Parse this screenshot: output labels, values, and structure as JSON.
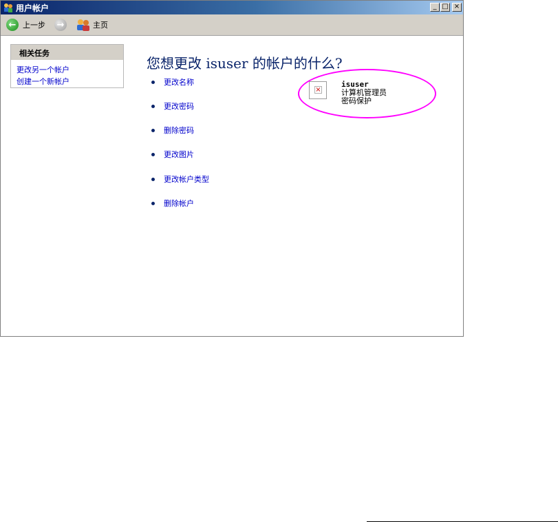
{
  "window": {
    "title": "用户帐户"
  },
  "title_buttons": {
    "minimize": "_",
    "maximize": "□",
    "close": "×"
  },
  "toolbar": {
    "back_label": "上一步",
    "home_label": "主页"
  },
  "task_panel": {
    "header": "相关任务",
    "links": [
      "更改另一个帐户",
      "创建一个新帐户"
    ]
  },
  "main": {
    "title": "您想更改 isuser 的帐户的什么?",
    "options": [
      "更改名称",
      "更改密码",
      "删除密码",
      "更改图片",
      "更改帐户类型",
      "删除帐户"
    ]
  },
  "user_card": {
    "name": "isuser",
    "type": "计算机管理员",
    "status": "密码保护"
  },
  "colors": {
    "highlight": "#ff00ff",
    "link": "#0000cc",
    "title": "#0a246a"
  },
  "icons": {
    "back": "arrow-left-icon",
    "forward": "arrow-right-icon",
    "home": "users-icon"
  }
}
